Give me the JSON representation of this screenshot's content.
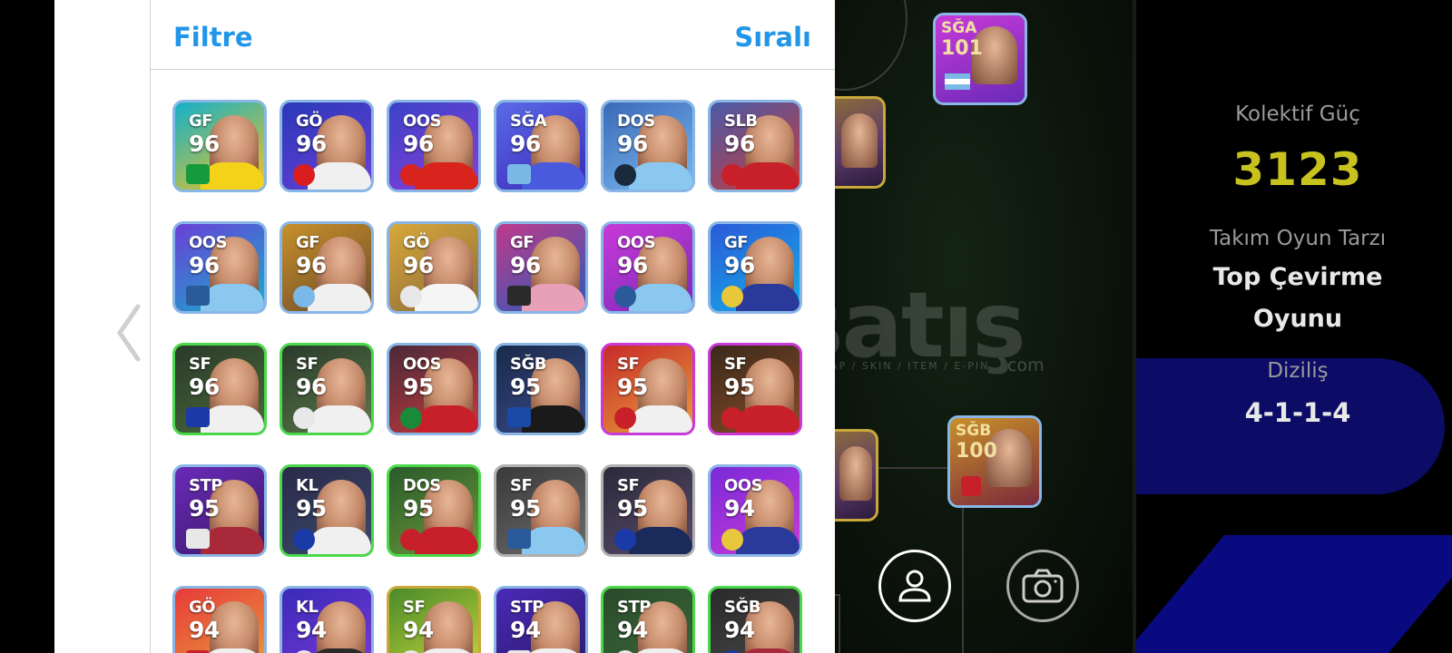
{
  "topbar": {
    "filter_label": "Filtre",
    "sort_label": "Sıralı"
  },
  "cards": [
    {
      "pos": "GF",
      "rating": "96",
      "bg": [
        "#14b0c9",
        "#f2c51e"
      ],
      "body": "#f5d21a",
      "badge": "#169b3c",
      "border": "#8ab6e6"
    },
    {
      "pos": "GÖ",
      "rating": "96",
      "bg": [
        "#2a39b8",
        "#6a3fd8"
      ],
      "body": "#f0f0f0",
      "badge": "#d81e1e",
      "border": "#8ab6e6"
    },
    {
      "pos": "OOS",
      "rating": "96",
      "bg": [
        "#3a42c8",
        "#8a3fd8"
      ],
      "body": "#d9241e",
      "badge": "#d9241e",
      "border": "#8ab6e6"
    },
    {
      "pos": "SĞA",
      "rating": "96",
      "bg": [
        "#5a6ae8",
        "#3a2ab8"
      ],
      "body": "#4a5adf",
      "badge": "#7ab8e8",
      "border": "#8ab6e6"
    },
    {
      "pos": "DOS",
      "rating": "96",
      "bg": [
        "#3a6ab8",
        "#7ab8f0"
      ],
      "body": "#8ac8f0",
      "badge": "#1a2a3a",
      "border": "#8ab6e6"
    },
    {
      "pos": "SLB",
      "rating": "96",
      "bg": [
        "#4a5aa8",
        "#c83a3a"
      ],
      "body": "#c8202a",
      "badge": "#c8202a",
      "border": "#8ab6e6"
    },
    {
      "pos": "OOS",
      "rating": "96",
      "bg": [
        "#6a3fd8",
        "#14b0c9"
      ],
      "body": "#8ac8f0",
      "badge": "#2a5a9a",
      "border": "#8ab6e6"
    },
    {
      "pos": "GF",
      "rating": "96",
      "bg": [
        "#c8902a",
        "#6a4a2a"
      ],
      "body": "#f0f0f0",
      "badge": "#7ab8e8",
      "border": "#8ab6e6"
    },
    {
      "pos": "GÖ",
      "rating": "96",
      "bg": [
        "#d8a83a",
        "#8a6a3a"
      ],
      "body": "#f5f5f5",
      "badge": "#e8e8e8",
      "border": "#8ab6e6"
    },
    {
      "pos": "GF",
      "rating": "96",
      "bg": [
        "#c03a8a",
        "#2a5ab8"
      ],
      "body": "#e8a0b8",
      "badge": "#2a2a2a",
      "border": "#8ab6e6"
    },
    {
      "pos": "OOS",
      "rating": "96",
      "bg": [
        "#c83ad8",
        "#7a2ab8"
      ],
      "body": "#8ac8f0",
      "badge": "#2a5a9a",
      "border": "#8ab6e6"
    },
    {
      "pos": "GF",
      "rating": "96",
      "bg": [
        "#2a5ad8",
        "#14b0e8"
      ],
      "body": "#2a3a9a",
      "badge": "#e8c83a",
      "border": "#8ab6e6"
    },
    {
      "pos": "SF",
      "rating": "96",
      "bg": [
        "#2a3a2a",
        "#4a6a3a"
      ],
      "body": "#f0f0f0",
      "badge": "#1a3aa8",
      "border": "#4ad84a"
    },
    {
      "pos": "SF",
      "rating": "96",
      "bg": [
        "#2a3a2a",
        "#5a7a4a"
      ],
      "body": "#f0f0f0",
      "badge": "#e8e8e8",
      "border": "#4ad84a"
    },
    {
      "pos": "OOS",
      "rating": "95",
      "bg": [
        "#4a2a3a",
        "#c83a3a"
      ],
      "body": "#c8202a",
      "badge": "#1a8a3a",
      "border": "#8ab6e6"
    },
    {
      "pos": "SĞB",
      "rating": "95",
      "bg": [
        "#1a2a4a",
        "#3a4a8a"
      ],
      "body": "#1a1a1a",
      "badge": "#1a4aa8",
      "border": "#8ab6e6"
    },
    {
      "pos": "SF",
      "rating": "95",
      "bg": [
        "#c82a2a",
        "#e8a03a"
      ],
      "body": "#f0f0f0",
      "badge": "#c8202a",
      "border": "#c83ad8"
    },
    {
      "pos": "SF",
      "rating": "95",
      "bg": [
        "#3a2a1a",
        "#8a4a2a"
      ],
      "body": "#c8202a",
      "badge": "#c8202a",
      "border": "#c83ad8"
    },
    {
      "pos": "STP",
      "rating": "95",
      "bg": [
        "#6a2ab8",
        "#3a1a6a"
      ],
      "body": "#a82a3a",
      "badge": "#e8e8e8",
      "border": "#8ab6e6"
    },
    {
      "pos": "KL",
      "rating": "95",
      "bg": [
        "#2a2a4a",
        "#3a4a6a"
      ],
      "body": "#f0f0f0",
      "badge": "#1a3aa8",
      "border": "#4ad84a"
    },
    {
      "pos": "DOS",
      "rating": "95",
      "bg": [
        "#2a5a2a",
        "#6a9a3a"
      ],
      "body": "#c8202a",
      "badge": "#c8202a",
      "border": "#4ad84a"
    },
    {
      "pos": "SF",
      "rating": "95",
      "bg": [
        "#3a3a3a",
        "#6a6a6a"
      ],
      "body": "#8ac8f0",
      "badge": "#2a5a9a",
      "border": "#b0b0b0"
    },
    {
      "pos": "SF",
      "rating": "95",
      "bg": [
        "#2a2a3a",
        "#5a4a6a"
      ],
      "body": "#1a2a5a",
      "badge": "#1a3aa8",
      "border": "#b0b0b0"
    },
    {
      "pos": "OOS",
      "rating": "94",
      "bg": [
        "#7a2ad8",
        "#c83ad8"
      ],
      "body": "#2a3a9a",
      "badge": "#e8c83a",
      "border": "#8ab6e6"
    },
    {
      "pos": "GÖ",
      "rating": "94",
      "bg": [
        "#e83a3a",
        "#e8a03a"
      ],
      "body": "#f0f0f0",
      "badge": "#c8202a",
      "border": "#8ab6e6"
    },
    {
      "pos": "KL",
      "rating": "94",
      "bg": [
        "#3a2ab8",
        "#7a3ad8"
      ],
      "body": "#2a2a2a",
      "badge": "#e8e8e8",
      "border": "#8ab6e6"
    },
    {
      "pos": "SF",
      "rating": "94",
      "bg": [
        "#4a8a2a",
        "#c8d83a"
      ],
      "body": "#f0f0f0",
      "badge": "#e8e8e8",
      "border": "#c8a83a"
    },
    {
      "pos": "STP",
      "rating": "94",
      "bg": [
        "#4a2ab8",
        "#2a1a6a"
      ],
      "body": "#f0f0f0",
      "badge": "#e8e8e8",
      "border": "#8ab6e6"
    },
    {
      "pos": "STP",
      "rating": "94",
      "bg": [
        "#2a4a2a",
        "#3a6a3a"
      ],
      "body": "#f0f0f0",
      "badge": "#e8e8e8",
      "border": "#4ad84a"
    },
    {
      "pos": "SĞB",
      "rating": "94",
      "bg": [
        "#2a2a2a",
        "#4a4a4a"
      ],
      "body": "#a82a3a",
      "badge": "#1a3aa8",
      "border": "#4ad84a"
    }
  ],
  "field_cards": [
    {
      "pos": "SĞA",
      "rating": "101"
    },
    {
      "pos": "SĞB",
      "rating": "100"
    }
  ],
  "stats": {
    "power_label": "Kolektif Güç",
    "power_value": "3123",
    "style_label": "Takım Oyun Tarzı",
    "style_value_line1": "Top Çevirme",
    "style_value_line2": "Oyunu",
    "formation_label": "Diziliş",
    "formation_value": "4-1-1-4"
  },
  "watermark": {
    "main": "satış",
    "sub": "AP / SKIN / ITEM / E-PIN",
    "com": "com"
  },
  "icons": {
    "profile": "person-icon",
    "camera": "camera-icon",
    "back": "chevron-left-icon"
  },
  "colors": {
    "accent": "#2196e8",
    "power": "#c8c21e"
  }
}
